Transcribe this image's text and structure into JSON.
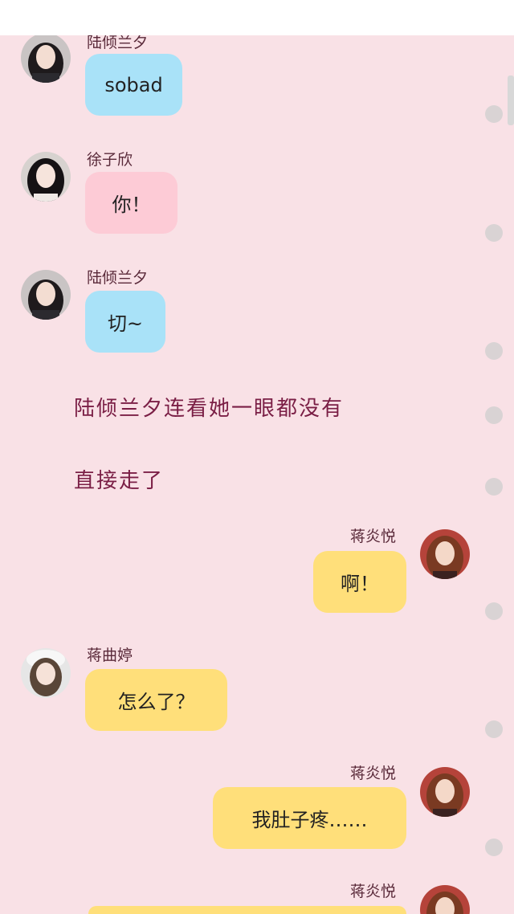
{
  "messages": [
    {
      "sender": "陆倾兰夕",
      "text": "sobad",
      "side": "left",
      "color": "blue",
      "avatar": "avatar-girl-dark-hair"
    },
    {
      "sender": "徐子欣",
      "text": "你！",
      "side": "left",
      "color": "pink",
      "avatar": "avatar-girl-long-hair"
    },
    {
      "sender": "陆倾兰夕",
      "text": "切~",
      "side": "left",
      "color": "blue",
      "avatar": "avatar-girl-dark-hair"
    },
    {
      "sender": "蒋炎悦",
      "text": "啊！",
      "side": "right",
      "color": "yellow",
      "avatar": "avatar-girl-auburn-hair"
    },
    {
      "sender": "蒋曲婷",
      "text": "怎么了？",
      "side": "left",
      "color": "yellow",
      "avatar": "avatar-girl-white-cap"
    },
    {
      "sender": "蒋炎悦",
      "text": "我肚子疼……",
      "side": "right",
      "color": "yellow",
      "avatar": "avatar-girl-auburn-hair"
    },
    {
      "sender": "蒋炎悦",
      "text": "",
      "side": "right",
      "color": "yellow",
      "avatar": "avatar-girl-auburn-hair"
    }
  ],
  "narration": [
    "陆倾兰夕连看她一眼都没有",
    "直接走了"
  ],
  "colors": {
    "background": "#f9e1e6",
    "bubble_blue": "#a9e2f8",
    "bubble_pink": "#fdcbd6",
    "bubble_yellow": "#ffdf7a",
    "narration_text": "#7a1e45"
  }
}
